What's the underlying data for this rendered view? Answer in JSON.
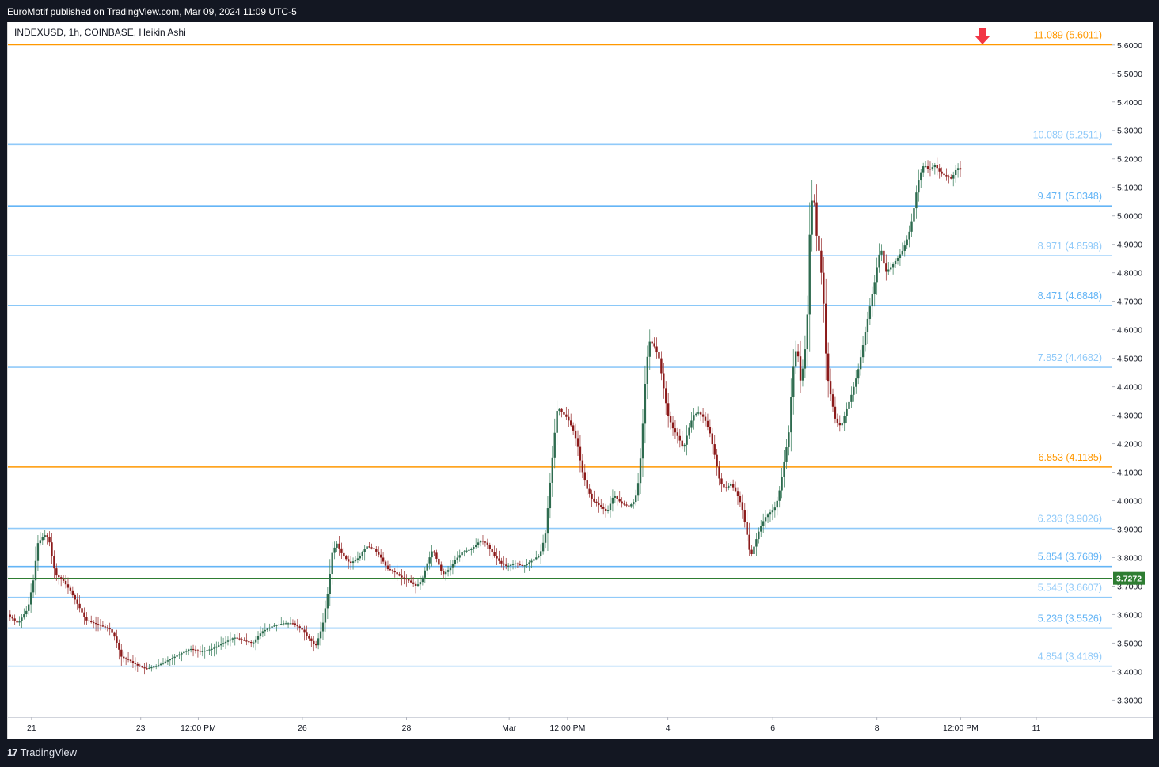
{
  "header": {
    "published_by": "EuroMotif published on TradingView.com, Mar 09, 2024 11:09 UTC-5"
  },
  "chart_data": {
    "type": "candlestick",
    "title": "INDEXUSD, 1h, COINBASE, Heikin Ashi",
    "symbol": "INDEXUSD",
    "interval": "1h",
    "exchange": "COINBASE",
    "style": "Heikin Ashi",
    "ylim": [
      3.24,
      5.68
    ],
    "y_ticks": [
      "3.3000",
      "3.4000",
      "3.5000",
      "3.6000",
      "3.7000",
      "3.8000",
      "3.9000",
      "4.0000",
      "4.1000",
      "4.2000",
      "4.3000",
      "4.4000",
      "4.5000",
      "4.6000",
      "4.7000",
      "4.8000",
      "4.9000",
      "5.0000",
      "5.1000",
      "5.2000",
      "5.3000",
      "5.4000",
      "5.5000",
      "5.6000"
    ],
    "x_ticks": [
      {
        "label": "21",
        "x": 0.0214
      },
      {
        "label": "23",
        "x": 0.1203
      },
      {
        "label": "12:00 PM",
        "x": 0.1725
      },
      {
        "label": "26",
        "x": 0.2668
      },
      {
        "label": "28",
        "x": 0.3612
      },
      {
        "label": "Mar",
        "x": 0.4542
      },
      {
        "label": "12:00 PM",
        "x": 0.5071
      },
      {
        "label": "4",
        "x": 0.598
      },
      {
        "label": "6",
        "x": 0.6931
      },
      {
        "label": "8",
        "x": 0.7874
      },
      {
        "label": "12:00 PM",
        "x": 0.8633
      },
      {
        "label": "11",
        "x": 0.9319
      }
    ],
    "current_price": "3.7272",
    "levels": [
      {
        "label": "11.089 (5.6011)",
        "price": 5.6011,
        "color": "#ff9800"
      },
      {
        "label": "10.089 (5.2511)",
        "price": 5.2511,
        "color": "#90caf9"
      },
      {
        "label": "9.471 (5.0348)",
        "price": 5.0348,
        "color": "#64b5f6"
      },
      {
        "label": "8.971 (4.8598)",
        "price": 4.8598,
        "color": "#90caf9"
      },
      {
        "label": "8.471 (4.6848)",
        "price": 4.6848,
        "color": "#64b5f6"
      },
      {
        "label": "7.852 (4.4682)",
        "price": 4.4682,
        "color": "#90caf9"
      },
      {
        "label": "6.853 (4.1185)",
        "price": 4.1185,
        "color": "#ff9800"
      },
      {
        "label": "6.236 (3.9026)",
        "price": 3.9026,
        "color": "#90caf9"
      },
      {
        "label": "5.854 (3.7689)",
        "price": 3.7689,
        "color": "#64b5f6"
      },
      {
        "label": "5.545 (3.6607)",
        "price": 3.6607,
        "color": "#90caf9"
      },
      {
        "label": "5.236 (3.5526)",
        "price": 3.5526,
        "color": "#64b5f6"
      },
      {
        "label": "4.854 (3.4189)",
        "price": 3.4189,
        "color": "#90caf9"
      }
    ],
    "price_path": [
      [
        0.0,
        3.6
      ],
      [
        0.009,
        3.57
      ],
      [
        0.018,
        3.62
      ],
      [
        0.023,
        3.72
      ],
      [
        0.027,
        3.85
      ],
      [
        0.033,
        3.88
      ],
      [
        0.037,
        3.87
      ],
      [
        0.04,
        3.8
      ],
      [
        0.043,
        3.74
      ],
      [
        0.05,
        3.72
      ],
      [
        0.057,
        3.68
      ],
      [
        0.064,
        3.63
      ],
      [
        0.071,
        3.58
      ],
      [
        0.078,
        3.57
      ],
      [
        0.085,
        3.56
      ],
      [
        0.092,
        3.55
      ],
      [
        0.097,
        3.52
      ],
      [
        0.103,
        3.45
      ],
      [
        0.11,
        3.44
      ],
      [
        0.118,
        3.42
      ],
      [
        0.125,
        3.41
      ],
      [
        0.135,
        3.42
      ],
      [
        0.145,
        3.44
      ],
      [
        0.155,
        3.46
      ],
      [
        0.165,
        3.48
      ],
      [
        0.175,
        3.47
      ],
      [
        0.185,
        3.48
      ],
      [
        0.195,
        3.5
      ],
      [
        0.205,
        3.52
      ],
      [
        0.213,
        3.51
      ],
      [
        0.222,
        3.5
      ],
      [
        0.23,
        3.54
      ],
      [
        0.24,
        3.56
      ],
      [
        0.25,
        3.57
      ],
      [
        0.258,
        3.57
      ],
      [
        0.266,
        3.55
      ],
      [
        0.272,
        3.52
      ],
      [
        0.279,
        3.49
      ],
      [
        0.285,
        3.56
      ],
      [
        0.29,
        3.68
      ],
      [
        0.294,
        3.82
      ],
      [
        0.298,
        3.85
      ],
      [
        0.303,
        3.81
      ],
      [
        0.31,
        3.78
      ],
      [
        0.318,
        3.8
      ],
      [
        0.325,
        3.84
      ],
      [
        0.332,
        3.83
      ],
      [
        0.338,
        3.8
      ],
      [
        0.344,
        3.76
      ],
      [
        0.35,
        3.75
      ],
      [
        0.357,
        3.73
      ],
      [
        0.363,
        3.72
      ],
      [
        0.37,
        3.7
      ],
      [
        0.375,
        3.72
      ],
      [
        0.38,
        3.78
      ],
      [
        0.385,
        3.83
      ],
      [
        0.39,
        3.78
      ],
      [
        0.394,
        3.74
      ],
      [
        0.4,
        3.76
      ],
      [
        0.405,
        3.79
      ],
      [
        0.412,
        3.82
      ],
      [
        0.42,
        3.83
      ],
      [
        0.428,
        3.86
      ],
      [
        0.434,
        3.85
      ],
      [
        0.44,
        3.81
      ],
      [
        0.447,
        3.78
      ],
      [
        0.452,
        3.77
      ],
      [
        0.46,
        3.78
      ],
      [
        0.467,
        3.77
      ],
      [
        0.475,
        3.79
      ],
      [
        0.482,
        3.81
      ],
      [
        0.487,
        3.88
      ],
      [
        0.491,
        4.05
      ],
      [
        0.495,
        4.22
      ],
      [
        0.498,
        4.33
      ],
      [
        0.502,
        4.31
      ],
      [
        0.507,
        4.29
      ],
      [
        0.512,
        4.25
      ],
      [
        0.516,
        4.2
      ],
      [
        0.52,
        4.11
      ],
      [
        0.525,
        4.04
      ],
      [
        0.53,
        4.0
      ],
      [
        0.537,
        3.98
      ],
      [
        0.543,
        3.96
      ],
      [
        0.549,
        4.02
      ],
      [
        0.556,
        3.99
      ],
      [
        0.563,
        3.98
      ],
      [
        0.568,
        4.0
      ],
      [
        0.572,
        4.08
      ],
      [
        0.575,
        4.25
      ],
      [
        0.578,
        4.45
      ],
      [
        0.581,
        4.56
      ],
      [
        0.585,
        4.55
      ],
      [
        0.59,
        4.5
      ],
      [
        0.594,
        4.4
      ],
      [
        0.598,
        4.3
      ],
      [
        0.603,
        4.25
      ],
      [
        0.608,
        4.22
      ],
      [
        0.612,
        4.18
      ],
      [
        0.616,
        4.24
      ],
      [
        0.621,
        4.3
      ],
      [
        0.626,
        4.31
      ],
      [
        0.631,
        4.29
      ],
      [
        0.636,
        4.24
      ],
      [
        0.641,
        4.15
      ],
      [
        0.645,
        4.07
      ],
      [
        0.65,
        4.04
      ],
      [
        0.655,
        4.06
      ],
      [
        0.66,
        4.03
      ],
      [
        0.665,
        3.98
      ],
      [
        0.669,
        3.9
      ],
      [
        0.673,
        3.8
      ],
      [
        0.677,
        3.85
      ],
      [
        0.681,
        3.9
      ],
      [
        0.686,
        3.94
      ],
      [
        0.691,
        3.96
      ],
      [
        0.696,
        3.98
      ],
      [
        0.7,
        4.05
      ],
      [
        0.704,
        4.15
      ],
      [
        0.708,
        4.25
      ],
      [
        0.711,
        4.45
      ],
      [
        0.715,
        4.55
      ],
      [
        0.718,
        4.42
      ],
      [
        0.721,
        4.48
      ],
      [
        0.724,
        4.6
      ],
      [
        0.727,
        5.0
      ],
      [
        0.73,
        5.1
      ],
      [
        0.732,
        4.95
      ],
      [
        0.736,
        4.85
      ],
      [
        0.739,
        4.7
      ],
      [
        0.742,
        4.45
      ],
      [
        0.746,
        4.36
      ],
      [
        0.75,
        4.28
      ],
      [
        0.755,
        4.26
      ],
      [
        0.76,
        4.32
      ],
      [
        0.765,
        4.38
      ],
      [
        0.77,
        4.45
      ],
      [
        0.775,
        4.55
      ],
      [
        0.78,
        4.66
      ],
      [
        0.785,
        4.76
      ],
      [
        0.789,
        4.86
      ],
      [
        0.792,
        4.88
      ],
      [
        0.795,
        4.8
      ],
      [
        0.8,
        4.82
      ],
      [
        0.806,
        4.85
      ],
      [
        0.811,
        4.88
      ],
      [
        0.816,
        4.93
      ],
      [
        0.82,
        5.0
      ],
      [
        0.823,
        5.08
      ],
      [
        0.826,
        5.14
      ],
      [
        0.83,
        5.18
      ],
      [
        0.835,
        5.16
      ],
      [
        0.84,
        5.18
      ],
      [
        0.845,
        5.15
      ],
      [
        0.85,
        5.14
      ],
      [
        0.855,
        5.13
      ],
      [
        0.86,
        5.17
      ],
      [
        0.864,
        5.16
      ]
    ],
    "grid": false,
    "legend": "none"
  }
}
